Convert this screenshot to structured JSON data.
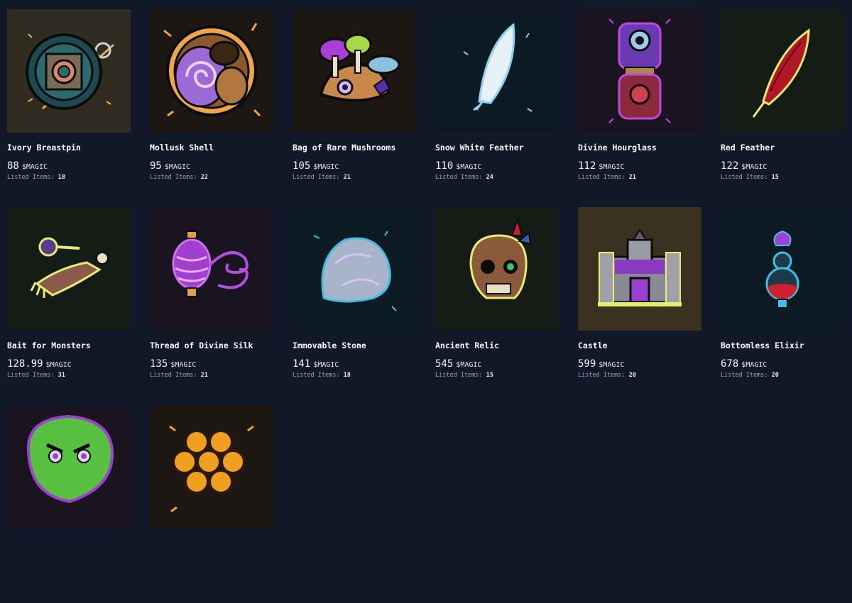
{
  "items": [
    {
      "name": "Ivory Breastpin",
      "price": "88",
      "currency": "$MAGIC",
      "listed_label": "Listed Items:",
      "listed": "18",
      "bg": "#302c22",
      "icon": "breastpin-icon"
    },
    {
      "name": "Mollusk Shell",
      "price": "95",
      "currency": "$MAGIC",
      "listed_label": "Listed Items:",
      "listed": "22",
      "bg": "#1c1712",
      "icon": "shell-icon"
    },
    {
      "name": "Bag of Rare Mushrooms",
      "price": "105",
      "currency": "$MAGIC",
      "listed_label": "Listed Items:",
      "listed": "21",
      "bg": "#1c1712",
      "icon": "mushroom-bag-icon"
    },
    {
      "name": "Snow White Feather",
      "price": "110",
      "currency": "$MAGIC",
      "listed_label": "Listed Items:",
      "listed": "24",
      "bg": "#0c1a24",
      "icon": "white-feather-icon"
    },
    {
      "name": "Divine Hourglass",
      "price": "112",
      "currency": "$MAGIC",
      "listed_label": "Listed Items:",
      "listed": "21",
      "bg": "#1a1420",
      "icon": "hourglass-icon"
    },
    {
      "name": "Red Feather",
      "price": "122",
      "currency": "$MAGIC",
      "listed_label": "Listed Items:",
      "listed": "15",
      "bg": "#151c16",
      "icon": "red-feather-icon"
    },
    {
      "name": "Bait for Monsters",
      "price": "128.99",
      "currency": "$MAGIC",
      "listed_label": "Listed Items:",
      "listed": "31",
      "bg": "#151c16",
      "icon": "bait-icon"
    },
    {
      "name": "Thread of Divine Silk",
      "price": "135",
      "currency": "$MAGIC",
      "listed_label": "Listed Items:",
      "listed": "21",
      "bg": "#1a1420",
      "icon": "silk-thread-icon"
    },
    {
      "name": "Immovable Stone",
      "price": "141",
      "currency": "$MAGIC",
      "listed_label": "Listed Items:",
      "listed": "18",
      "bg": "#0c1a24",
      "icon": "stone-icon"
    },
    {
      "name": "Ancient Relic",
      "price": "545",
      "currency": "$MAGIC",
      "listed_label": "Listed Items:",
      "listed": "15",
      "bg": "#151c16",
      "icon": "skull-relic-icon"
    },
    {
      "name": "Castle",
      "price": "599",
      "currency": "$MAGIC",
      "listed_label": "Listed Items:",
      "listed": "20",
      "bg": "#3a3120",
      "icon": "castle-icon"
    },
    {
      "name": "Bottomless Elixir",
      "price": "678",
      "currency": "$MAGIC",
      "listed_label": "Listed Items:",
      "listed": "20",
      "bg": "#0c1a24",
      "icon": "elixir-icon"
    },
    {
      "name": "",
      "price": "",
      "currency": "",
      "listed_label": "",
      "listed": "",
      "bg": "#1a1420",
      "icon": "goblin-icon"
    },
    {
      "name": "",
      "price": "",
      "currency": "",
      "listed_label": "",
      "listed": "",
      "bg": "#1c1712",
      "icon": "honeycomb-icon"
    }
  ]
}
